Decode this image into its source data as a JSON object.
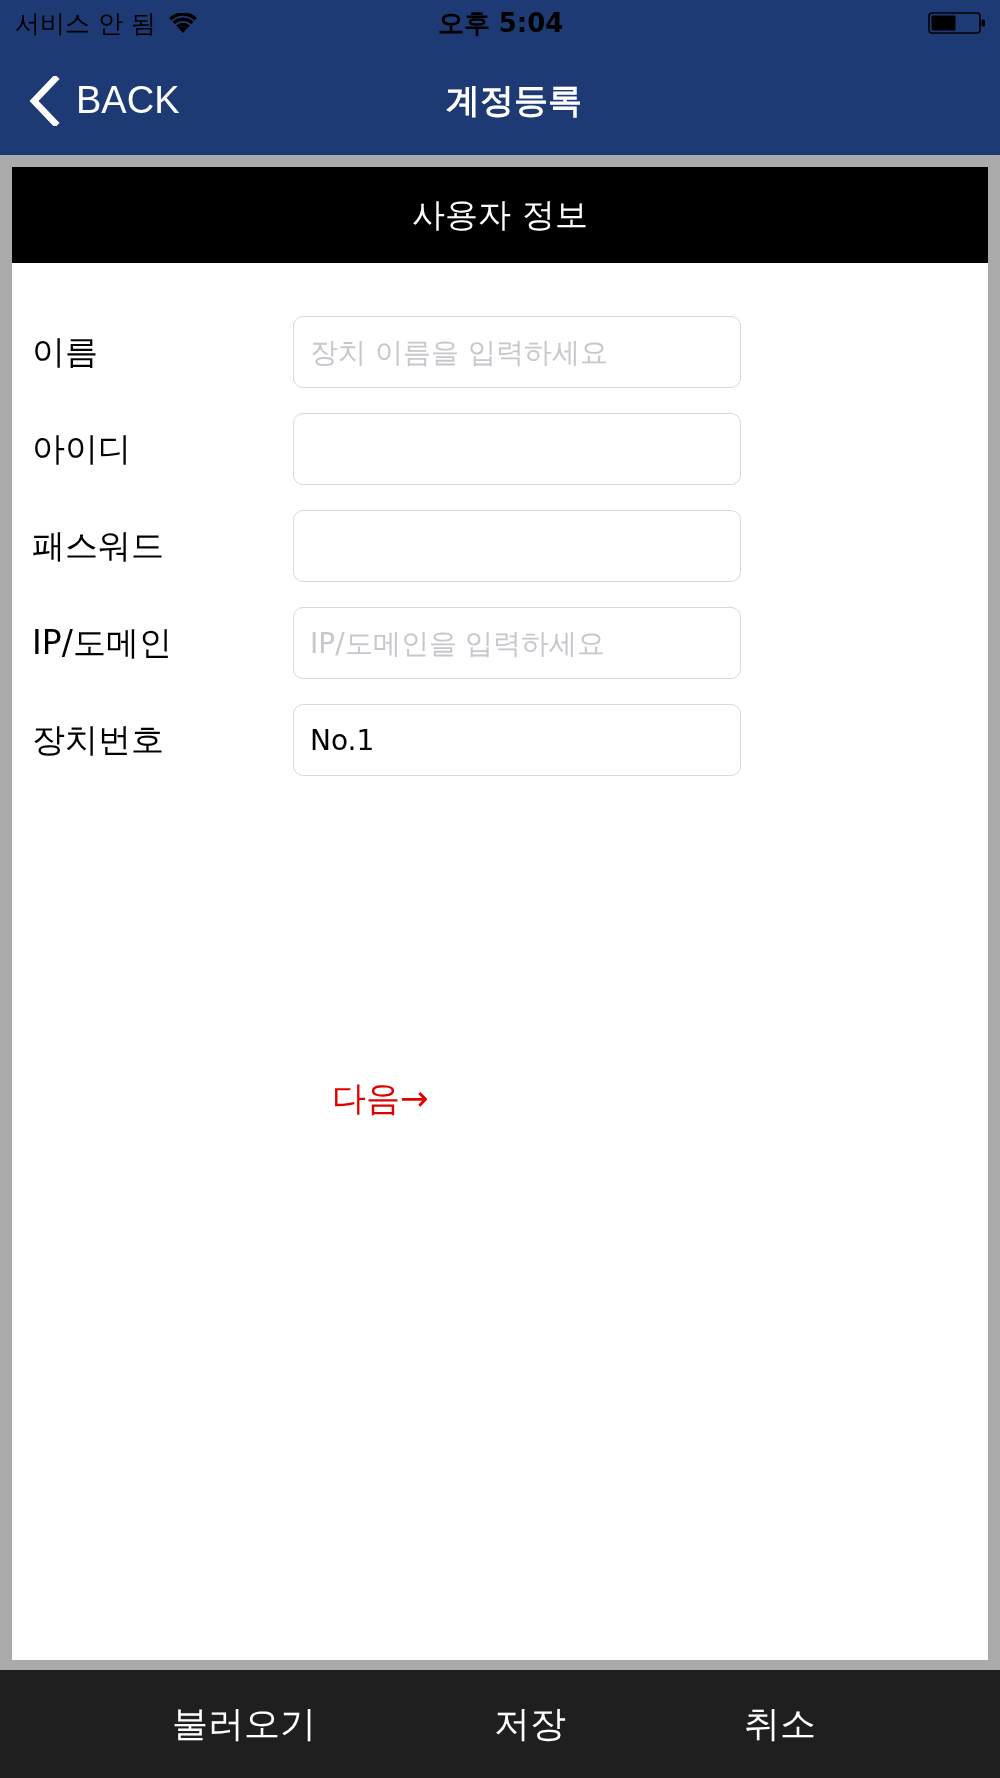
{
  "status_bar": {
    "carrier": "서비스 안 됨",
    "time": "오후 5:04"
  },
  "nav_bar": {
    "back_label": "BACK",
    "title": "계정등록"
  },
  "section": {
    "title": "사용자 정보"
  },
  "fields": [
    {
      "label": "이름",
      "placeholder": "장치 이름을 입력하세요"
    },
    {
      "label": "아이디"
    },
    {
      "label": "패스워드"
    },
    {
      "label": "IP/도메인",
      "placeholder": "IP/도메인을 입력하세요"
    },
    {
      "label": "장치번호",
      "value": "No.1"
    }
  ],
  "next_link": {
    "label": "다음→"
  },
  "toolbar": {
    "buttons": [
      "불러오기",
      "저장",
      "취소"
    ]
  }
}
